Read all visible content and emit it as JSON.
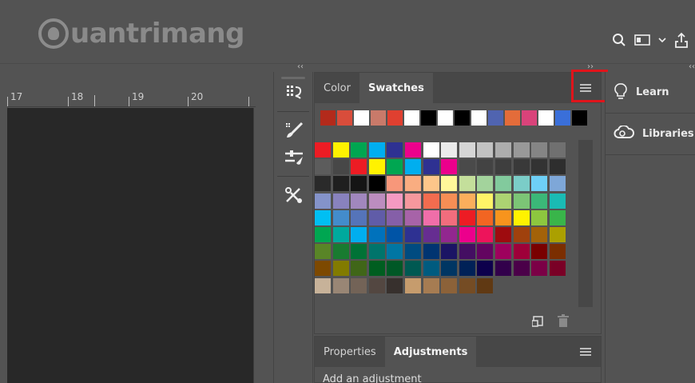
{
  "watermark": {
    "text": "uantrimang"
  },
  "top_bar": {
    "icons": [
      "search-icon",
      "workspace-icon",
      "chevron-down-icon",
      "share-icon"
    ]
  },
  "collapse_arrows": {
    "left": "‹‹",
    "middle": "››",
    "right": "‹‹"
  },
  "ruler": {
    "labels": [
      "17",
      "18",
      "19",
      "20"
    ]
  },
  "tools": [
    "brush-settings-icon",
    "brush-icon",
    "adjust-brush-icon",
    "tools-icon"
  ],
  "swatches_panel": {
    "tabs": [
      {
        "label": "Color",
        "active": false
      },
      {
        "label": "Swatches",
        "active": true
      }
    ],
    "menu_icon": "panel-menu-icon",
    "recent_colors": [
      "#b32a1b",
      "#d94d3b",
      "#ffffff",
      "#c97a6a",
      "#e04030",
      "#ffffff",
      "#000000",
      "#ffffff",
      "#000000",
      "#ffffff",
      "#5064b0",
      "#e36c3a",
      "#d9437a",
      "#ffffff",
      "#3a6fd9",
      "#000000"
    ],
    "grid_rows": [
      [
        "#ed1c24",
        "#fff200",
        "#00a651",
        "#00aeef",
        "#2e3192",
        "#ec008c",
        "#ffffff",
        "#ebebeb",
        "#d6d6d6",
        "#c2c2c2",
        "#adadad",
        "#999999",
        "#858585",
        "#707070"
      ],
      [
        "#5c5c5c",
        "#474747",
        "#ed1c24",
        "#fff200",
        "#00a651",
        "#00aeef",
        "#2e3192",
        "#ec008c",
        "#4a4a4a",
        "#434343",
        "#3e3e3e",
        "#393939",
        "#333333",
        "#2e2e2e"
      ],
      [
        "#2a2a2a",
        "#1f1f1f",
        "#141414",
        "#000000",
        "#f7977a",
        "#f9ad81",
        "#fdc68a",
        "#fff79a",
        "#c4df9b",
        "#a3d39c",
        "#82ca9d",
        "#7bcdc8",
        "#6ecff6",
        "#7ea7d8"
      ],
      [
        "#8493ca",
        "#8882be",
        "#a187be",
        "#bc8dbf",
        "#f49ac2",
        "#f6989d",
        "#f26c4f",
        "#f68e55",
        "#fbaf5c",
        "#fff467",
        "#acd372",
        "#7cc576",
        "#3bb878",
        "#1abbb4"
      ],
      [
        "#00bff3",
        "#438ccb",
        "#5574b9",
        "#605ca8",
        "#855fa8",
        "#a763a8",
        "#f06ea9",
        "#f26d7d",
        "#ed1c24",
        "#f26522",
        "#f7941d",
        "#fff200",
        "#8dc73f",
        "#39b54a"
      ],
      [
        "#00a651",
        "#00a99d",
        "#00aeef",
        "#0072bc",
        "#0054a6",
        "#2e3192",
        "#662d91",
        "#92278f",
        "#ec008c",
        "#ed145b",
        "#9e0b0f",
        "#a0410d",
        "#a36209",
        "#aba000"
      ],
      [
        "#598527",
        "#197b30",
        "#007236",
        "#00746b",
        "#0076a3",
        "#004b80",
        "#003471",
        "#1b1464",
        "#440e62",
        "#630460",
        "#9e005d",
        "#9e0039",
        "#790000",
        "#7b2e00"
      ],
      [
        "#7d4900",
        "#827b00",
        "#406618",
        "#005e20",
        "#005826",
        "#005952",
        "#005b7f",
        "#003663",
        "#002157",
        "#0d004c",
        "#32004b",
        "#4b0049",
        "#7b0046",
        "#7a0026"
      ],
      [
        "#c7b299",
        "#998675",
        "#736357",
        "#534741",
        "#37302d",
        "#c69c6d",
        "#a67c52",
        "#8c6239",
        "#754c24",
        "#603913"
      ]
    ],
    "footer_icons": [
      "new-swatch-icon",
      "trash-icon"
    ]
  },
  "adjustments_panel": {
    "tabs": [
      {
        "label": "Properties",
        "active": false
      },
      {
        "label": "Adjustments",
        "active": true
      }
    ],
    "hint": "Add an adjustment"
  },
  "right_panel": {
    "items": [
      {
        "label": "Learn",
        "icon": "lightbulb-icon"
      },
      {
        "label": "Libraries",
        "icon": "creative-cloud-icon"
      }
    ]
  },
  "colors": {
    "highlight": "#e0141b",
    "panel_bg": "#535353",
    "canvas_bg": "#282828"
  }
}
